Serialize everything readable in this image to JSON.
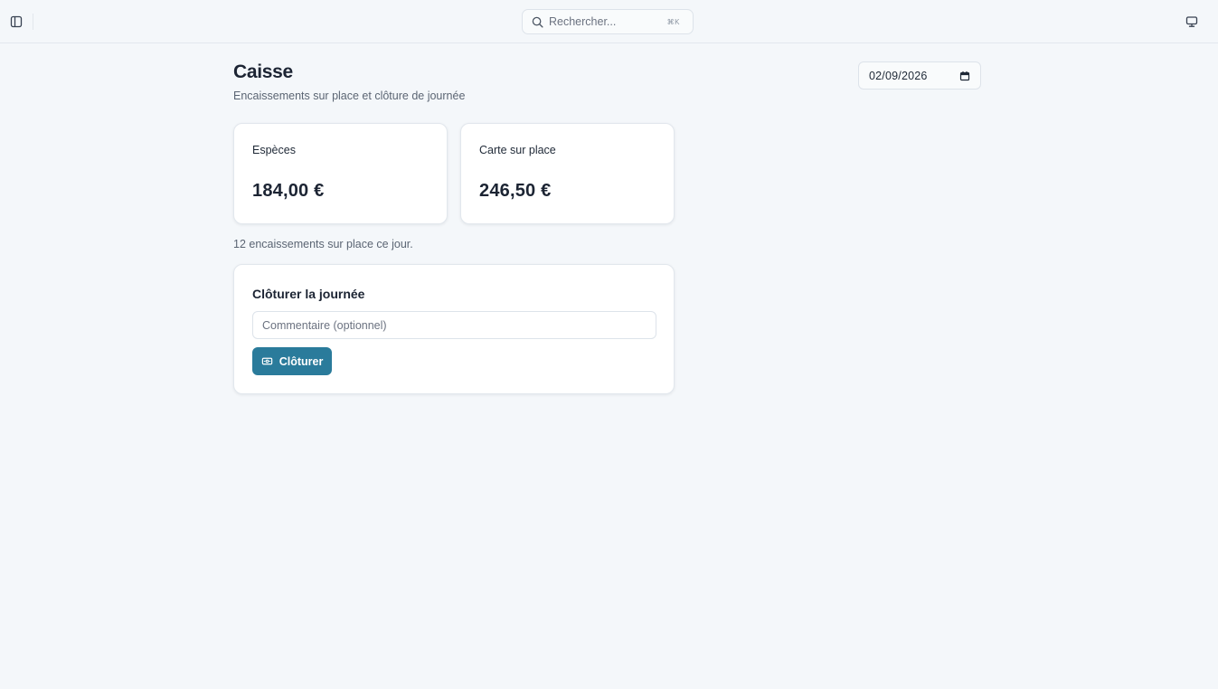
{
  "topbar": {
    "search": {
      "placeholder": "Rechercher...",
      "shortcut": "⌘K"
    }
  },
  "page": {
    "title": "Caisse",
    "subtitle": "Encaissements sur place et clôture de journée",
    "date": "02/09/2026"
  },
  "stats": [
    {
      "label": "Espèces",
      "value": "184,00 €"
    },
    {
      "label": "Carte sur place",
      "value": "246,50 €"
    }
  ],
  "summary": {
    "count_text": "12 encaissements sur place ce jour."
  },
  "closing": {
    "title": "Clôturer la journée",
    "comment_placeholder": "Commentaire (optionnel)",
    "comment_value": "",
    "button_label": "Clôturer"
  },
  "colors": {
    "background": "#f4f7fa",
    "accent": "#2a7b9b",
    "card": "#ffffff",
    "text_primary": "#1c2433",
    "text_muted": "#5b6573"
  },
  "icons": {
    "sidebar_toggle": "sidebar-panel-icon",
    "search": "search-icon",
    "display": "monitor-icon",
    "calendar": "calendar-icon",
    "close_button": "cash-register-icon"
  }
}
